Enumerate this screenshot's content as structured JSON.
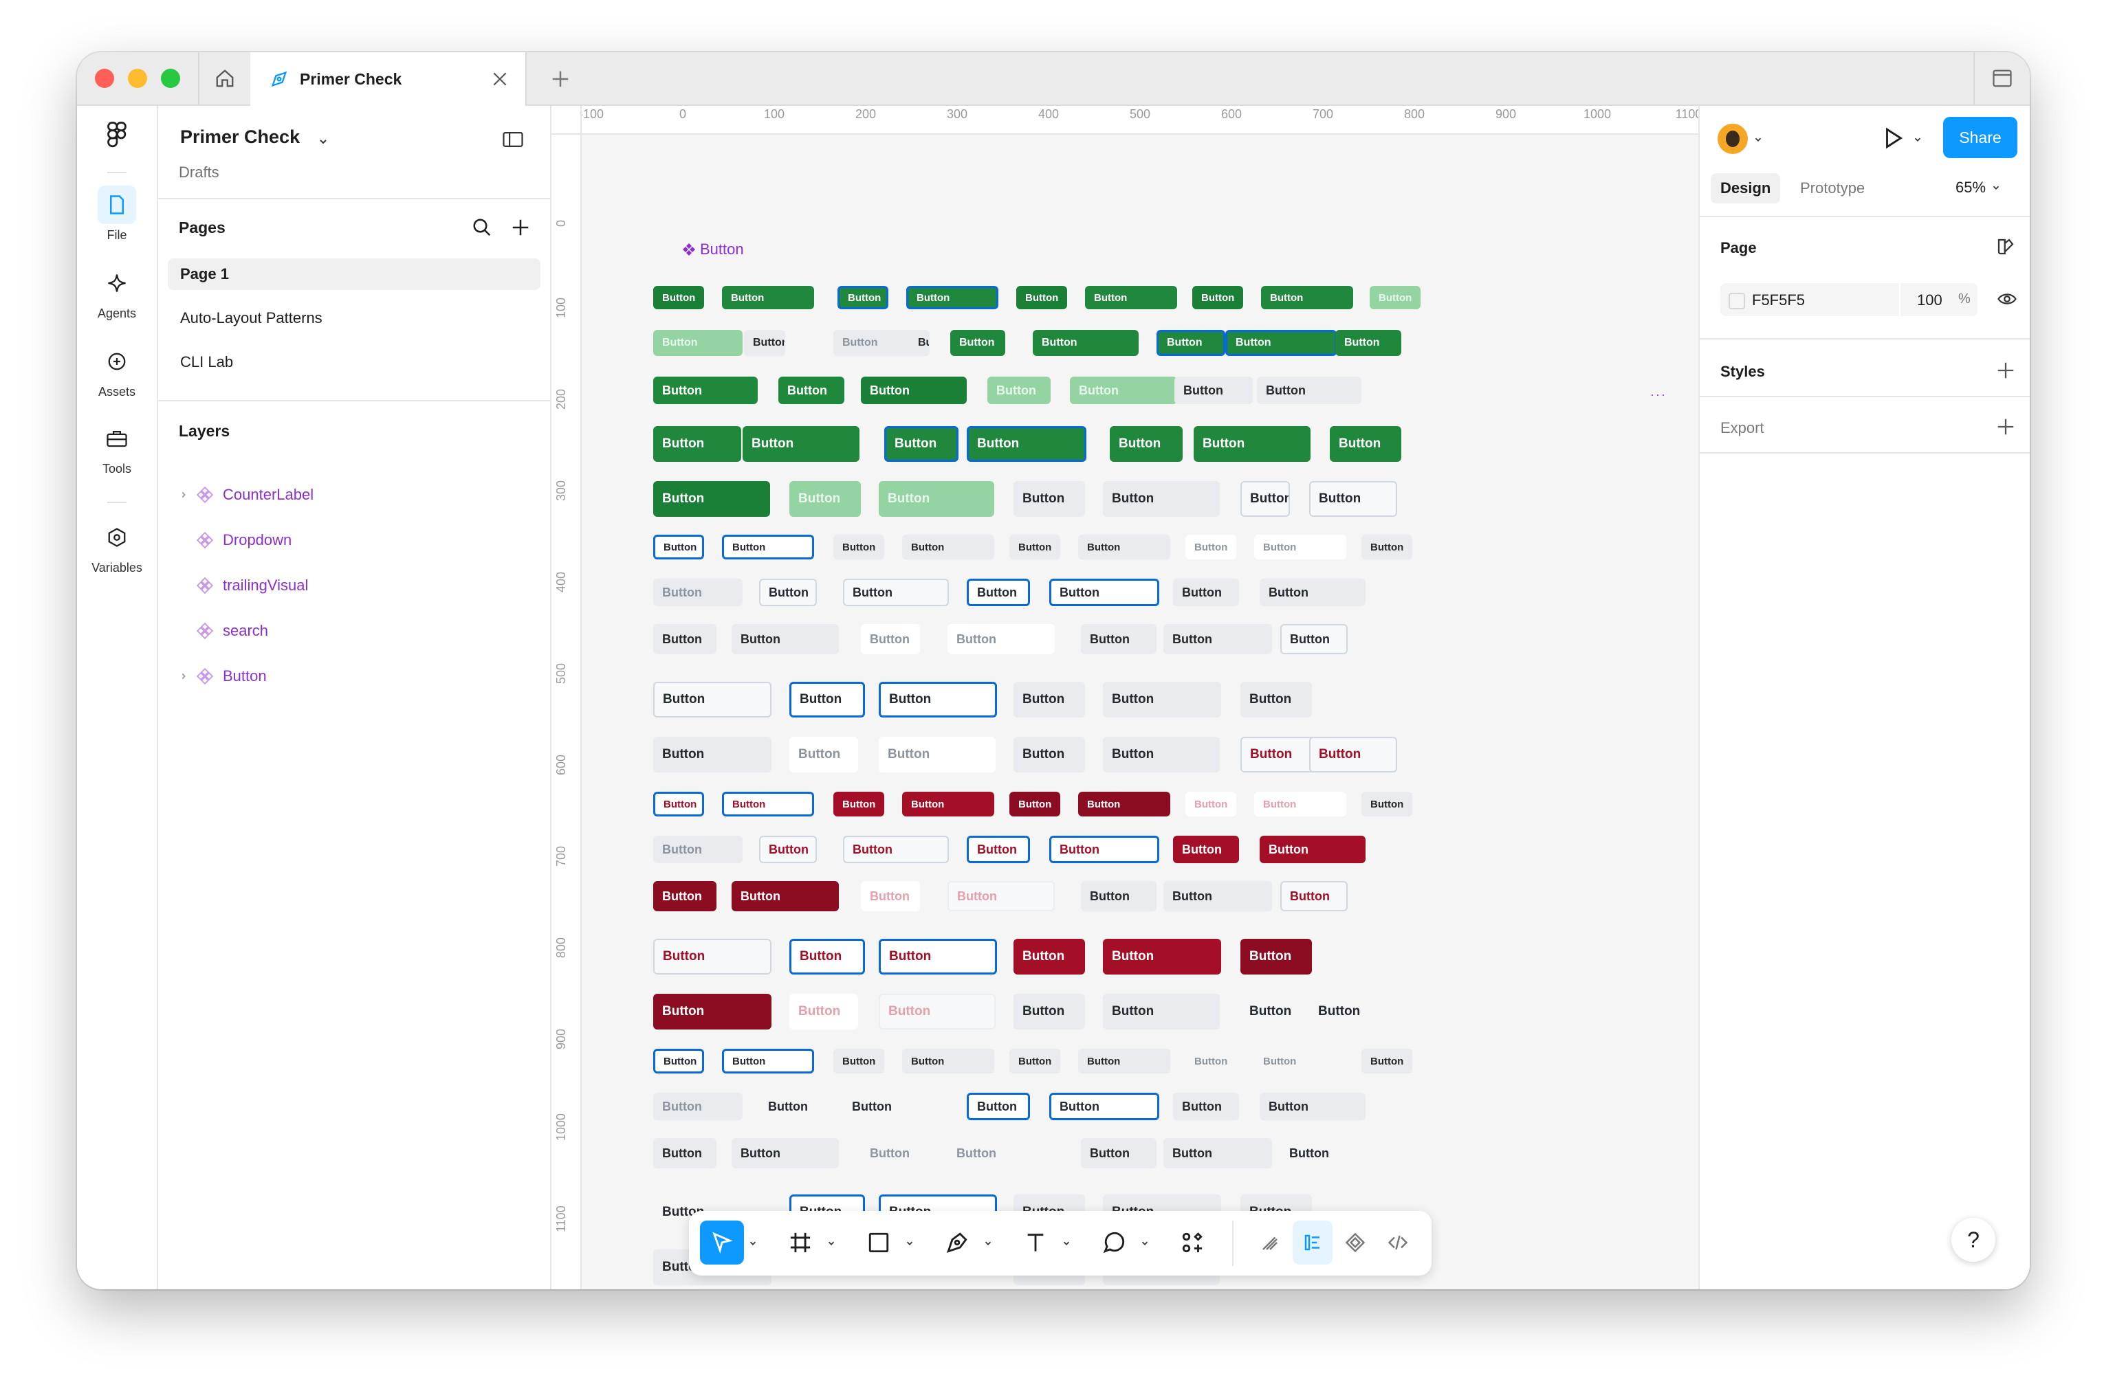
{
  "window": {
    "tab_title": "Primer Check"
  },
  "rail": {
    "items": [
      {
        "label": "File",
        "icon": "file-icon"
      },
      {
        "label": "Agents",
        "icon": "sparkle-icon"
      },
      {
        "label": "Assets",
        "icon": "plus-circle-icon"
      },
      {
        "label": "Tools",
        "icon": "toolbox-icon"
      },
      {
        "label": "Variables",
        "icon": "hexagon-icon"
      }
    ]
  },
  "panel": {
    "project_title": "Primer Check",
    "project_subtitle": "Drafts",
    "pages_title": "Pages",
    "pages": [
      "Page 1",
      "Auto-Layout Patterns",
      "CLI Lab"
    ],
    "layers_title": "Layers",
    "layers": [
      {
        "name": "CounterLabel",
        "expandable": true
      },
      {
        "name": "Dropdown",
        "expandable": false
      },
      {
        "name": "trailingVisual",
        "expandable": false
      },
      {
        "name": "search",
        "expandable": false
      },
      {
        "name": "Button",
        "expandable": true
      }
    ]
  },
  "canvas": {
    "ruler_x": [
      "-100",
      "0",
      "100",
      "200",
      "300",
      "400",
      "500",
      "600",
      "700",
      "800",
      "900",
      "1000",
      "1100"
    ],
    "ruler_y": [
      "0",
      "100",
      "200",
      "300",
      "400",
      "500",
      "600",
      "700",
      "800",
      "900",
      "1000",
      "1100"
    ],
    "frame_label": "Button",
    "button_label": "Button",
    "colors": {
      "green": "#1f883d",
      "green_dark": "#1a7f37",
      "green_disabled": "#94d3a2",
      "red": "#a40e26",
      "red_dark": "#8c0d22",
      "gray_bg": "#e9ebef",
      "focus_border": "#0969da",
      "canvas_bg": "#f5f5f5"
    }
  },
  "right_panel": {
    "share_label": "Share",
    "tabs": [
      "Design",
      "Prototype"
    ],
    "zoom": "65%",
    "page_section": "Page",
    "page_color": "F5F5F5",
    "page_opacity": "100",
    "percent_sign": "%",
    "styles_section": "Styles",
    "export_section": "Export",
    "help_label": "?"
  }
}
